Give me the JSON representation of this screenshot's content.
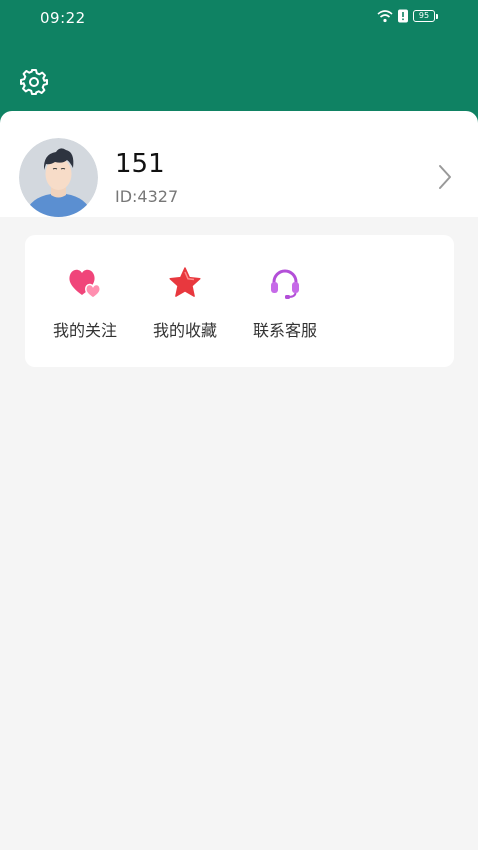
{
  "status_bar": {
    "time": "09:22",
    "battery": "95",
    "icons": [
      "wifi-icon",
      "alert-icon",
      "battery-icon"
    ]
  },
  "header": {
    "background": "#0f8263",
    "settings_icon": "gear-icon"
  },
  "profile": {
    "name": "151",
    "id_text": "ID:4327",
    "avatar": "avatar-icon",
    "chevron": "chevron-right-icon"
  },
  "actions": [
    {
      "label": "我的关注",
      "icon": "hearts-icon",
      "color": "#f0457a"
    },
    {
      "label": "我的收藏",
      "icon": "star-icon",
      "color": "#e8383e"
    },
    {
      "label": "联系客服",
      "icon": "headset-icon",
      "color": "#b34fd8"
    }
  ]
}
